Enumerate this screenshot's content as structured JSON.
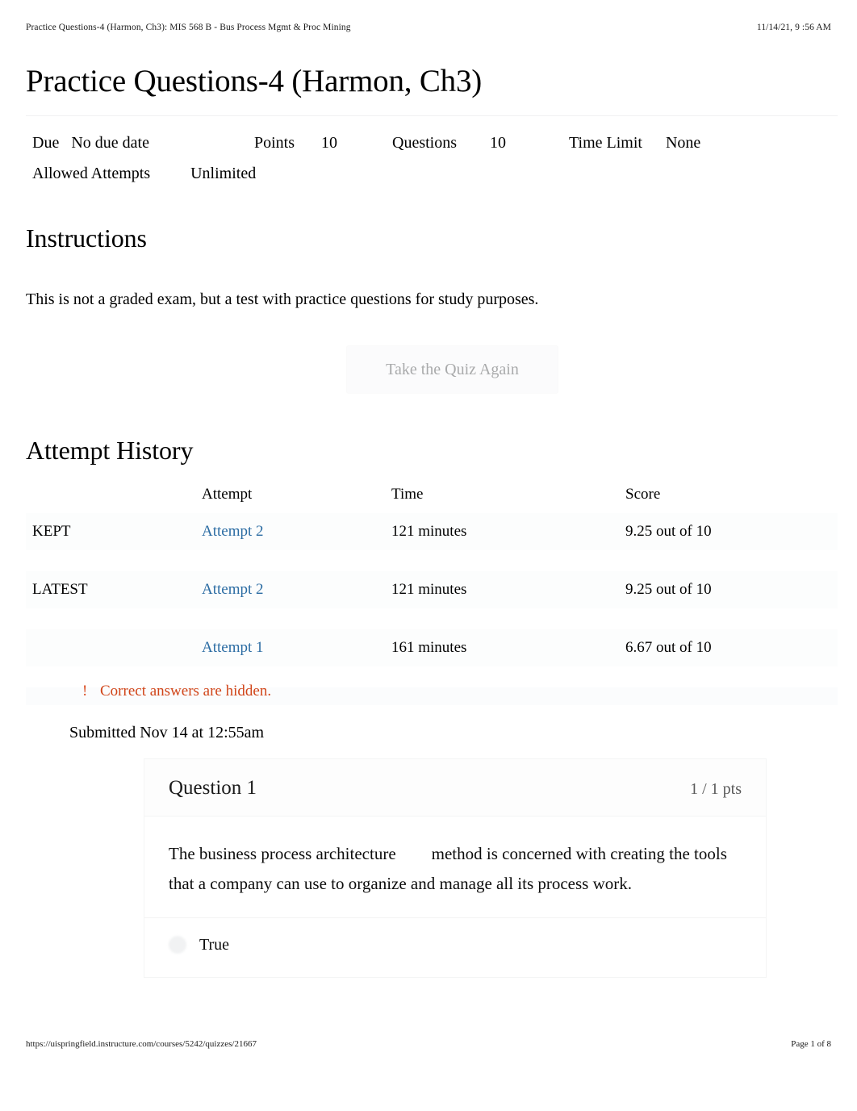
{
  "print_header": {
    "left": "Practice Questions-4 (Harmon, Ch3): MIS 568 B - Bus Process Mgmt & Proc Mining",
    "right": "11/14/21, 9 :56 AM"
  },
  "print_footer": {
    "url": "https://uispringfield.instructure.com/courses/5242/quizzes/21667",
    "page": "Page 1 of 8"
  },
  "quiz": {
    "title": "Practice Questions-4 (Harmon, Ch3)",
    "meta": {
      "due_label": "Due",
      "due_value": "No due date",
      "points_label": "Points",
      "points_value": "10",
      "questions_label": "Questions",
      "questions_value": "10",
      "time_limit_label": "Time Limit",
      "time_limit_value": "None",
      "allowed_attempts_label": "Allowed Attempts",
      "allowed_attempts_value": "Unlimited"
    }
  },
  "instructions": {
    "heading": "Instructions",
    "body": "This is not a graded exam, but a test with practice questions for study purposes."
  },
  "retake_button": {
    "label": "Take the Quiz Again"
  },
  "attempt_history": {
    "heading": "Attempt History",
    "columns": {
      "flag": "",
      "attempt": "Attempt",
      "time": "Time",
      "score": "Score"
    },
    "rows": [
      {
        "flag": "KEPT",
        "attempt": "Attempt 2",
        "time": "121 minutes",
        "score": "9.25 out of 10"
      },
      {
        "flag": "LATEST",
        "attempt": "Attempt 2",
        "time": "121 minutes",
        "score": "9.25 out of 10"
      },
      {
        "flag": "",
        "attempt": "Attempt 1",
        "time": "161 minutes",
        "score": "6.67 out of 10"
      }
    ]
  },
  "notice": {
    "icon": "!",
    "text": "Correct answers are hidden.",
    "color": "#d14519"
  },
  "submission": {
    "text": "Submitted Nov 14 at 12:55am"
  },
  "question": {
    "title": "Question 1",
    "points": "1 / 1 pts",
    "text_part1": "The  business process architecture",
    "text_part2": "method is concerned with creating the tools that a company can use to organize and manage all its process work.",
    "answers": [
      {
        "label": "True"
      }
    ]
  },
  "colors": {
    "link": "#2b6ca3",
    "warning": "#d14519",
    "muted": "#a9aaab"
  }
}
